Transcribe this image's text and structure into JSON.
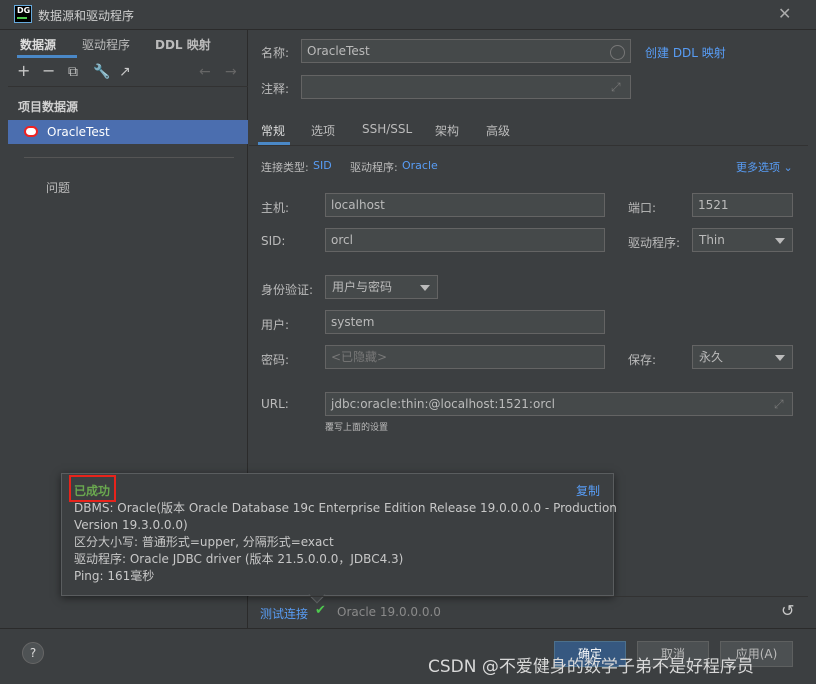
{
  "window": {
    "title": "数据源和驱动程序",
    "app_icon_text": "DG"
  },
  "left": {
    "tabs": [
      "数据源",
      "驱动程序",
      "DDL 映射"
    ],
    "section_label": "项目数据源",
    "datasource": "OracleTest",
    "problems": "问题"
  },
  "form": {
    "name_label": "名称:",
    "name_value": "OracleTest",
    "create_ddl": "创建 DDL 映射",
    "comment_label": "注释:",
    "comment_value": "",
    "tabs": [
      "常规",
      "选项",
      "SSH/SSL",
      "架构",
      "高级"
    ],
    "conn_type_label": "连接类型:",
    "conn_type_value": "SID",
    "driver_label": "驱动程序:",
    "driver_value": "Oracle",
    "more_options": "更多选项",
    "host_label": "主机:",
    "host_value": "localhost",
    "port_label": "端口:",
    "port_value": "1521",
    "sid_label": "SID:",
    "sid_value": "orcl",
    "driver2_label": "驱动程序:",
    "driver2_value": "Thin",
    "auth_label": "身份验证:",
    "auth_value": "用户与密码",
    "user_label": "用户:",
    "user_value": "system",
    "password_label": "密码:",
    "password_placeholder": "<已隐藏>",
    "save_label": "保存:",
    "save_value": "永久",
    "url_label": "URL:",
    "url_value": "jdbc:oracle:thin:@localhost:1521:orcl",
    "url_note": "覆写上面的设置"
  },
  "popup": {
    "status": "已成功",
    "copy": "复制",
    "lines": [
      "DBMS: Oracle(版本 Oracle Database 19c Enterprise Edition Release 19.0.0.0.0 - Production",
      "Version 19.3.0.0.0)",
      "区分大小写: 普通形式=upper, 分隔形式=exact",
      "驱动程序: Oracle JDBC driver (版本 21.5.0.0.0，JDBC4.3)",
      "Ping: 161毫秒"
    ]
  },
  "status_bar": {
    "test_connection": "测试连接",
    "version": "Oracle 19.0.0.0.0"
  },
  "footer": {
    "help": "?",
    "ok": "确定",
    "cancel": "取消",
    "apply": "应用(A)"
  },
  "watermark": "CSDN @不爱健身的数学子弟不是好程序员"
}
